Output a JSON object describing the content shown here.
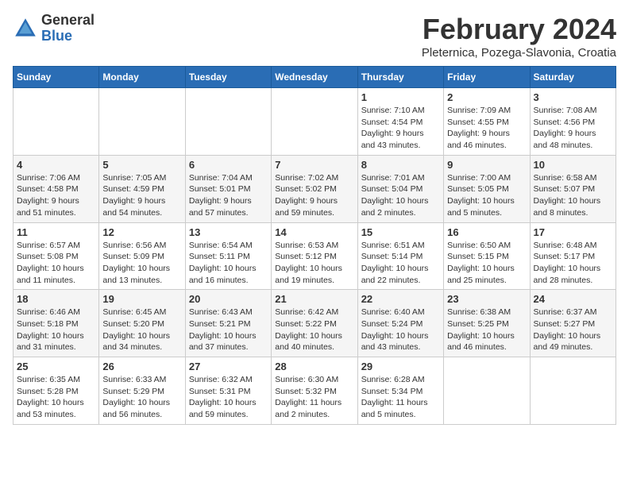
{
  "logo": {
    "general": "General",
    "blue": "Blue"
  },
  "header": {
    "month": "February 2024",
    "location": "Pleternica, Pozega-Slavonia, Croatia"
  },
  "weekdays": [
    "Sunday",
    "Monday",
    "Tuesday",
    "Wednesday",
    "Thursday",
    "Friday",
    "Saturday"
  ],
  "weeks": [
    [
      {
        "day": "",
        "detail": ""
      },
      {
        "day": "",
        "detail": ""
      },
      {
        "day": "",
        "detail": ""
      },
      {
        "day": "",
        "detail": ""
      },
      {
        "day": "1",
        "detail": "Sunrise: 7:10 AM\nSunset: 4:54 PM\nDaylight: 9 hours\nand 43 minutes."
      },
      {
        "day": "2",
        "detail": "Sunrise: 7:09 AM\nSunset: 4:55 PM\nDaylight: 9 hours\nand 46 minutes."
      },
      {
        "day": "3",
        "detail": "Sunrise: 7:08 AM\nSunset: 4:56 PM\nDaylight: 9 hours\nand 48 minutes."
      }
    ],
    [
      {
        "day": "4",
        "detail": "Sunrise: 7:06 AM\nSunset: 4:58 PM\nDaylight: 9 hours\nand 51 minutes."
      },
      {
        "day": "5",
        "detail": "Sunrise: 7:05 AM\nSunset: 4:59 PM\nDaylight: 9 hours\nand 54 minutes."
      },
      {
        "day": "6",
        "detail": "Sunrise: 7:04 AM\nSunset: 5:01 PM\nDaylight: 9 hours\nand 57 minutes."
      },
      {
        "day": "7",
        "detail": "Sunrise: 7:02 AM\nSunset: 5:02 PM\nDaylight: 9 hours\nand 59 minutes."
      },
      {
        "day": "8",
        "detail": "Sunrise: 7:01 AM\nSunset: 5:04 PM\nDaylight: 10 hours\nand 2 minutes."
      },
      {
        "day": "9",
        "detail": "Sunrise: 7:00 AM\nSunset: 5:05 PM\nDaylight: 10 hours\nand 5 minutes."
      },
      {
        "day": "10",
        "detail": "Sunrise: 6:58 AM\nSunset: 5:07 PM\nDaylight: 10 hours\nand 8 minutes."
      }
    ],
    [
      {
        "day": "11",
        "detail": "Sunrise: 6:57 AM\nSunset: 5:08 PM\nDaylight: 10 hours\nand 11 minutes."
      },
      {
        "day": "12",
        "detail": "Sunrise: 6:56 AM\nSunset: 5:09 PM\nDaylight: 10 hours\nand 13 minutes."
      },
      {
        "day": "13",
        "detail": "Sunrise: 6:54 AM\nSunset: 5:11 PM\nDaylight: 10 hours\nand 16 minutes."
      },
      {
        "day": "14",
        "detail": "Sunrise: 6:53 AM\nSunset: 5:12 PM\nDaylight: 10 hours\nand 19 minutes."
      },
      {
        "day": "15",
        "detail": "Sunrise: 6:51 AM\nSunset: 5:14 PM\nDaylight: 10 hours\nand 22 minutes."
      },
      {
        "day": "16",
        "detail": "Sunrise: 6:50 AM\nSunset: 5:15 PM\nDaylight: 10 hours\nand 25 minutes."
      },
      {
        "day": "17",
        "detail": "Sunrise: 6:48 AM\nSunset: 5:17 PM\nDaylight: 10 hours\nand 28 minutes."
      }
    ],
    [
      {
        "day": "18",
        "detail": "Sunrise: 6:46 AM\nSunset: 5:18 PM\nDaylight: 10 hours\nand 31 minutes."
      },
      {
        "day": "19",
        "detail": "Sunrise: 6:45 AM\nSunset: 5:20 PM\nDaylight: 10 hours\nand 34 minutes."
      },
      {
        "day": "20",
        "detail": "Sunrise: 6:43 AM\nSunset: 5:21 PM\nDaylight: 10 hours\nand 37 minutes."
      },
      {
        "day": "21",
        "detail": "Sunrise: 6:42 AM\nSunset: 5:22 PM\nDaylight: 10 hours\nand 40 minutes."
      },
      {
        "day": "22",
        "detail": "Sunrise: 6:40 AM\nSunset: 5:24 PM\nDaylight: 10 hours\nand 43 minutes."
      },
      {
        "day": "23",
        "detail": "Sunrise: 6:38 AM\nSunset: 5:25 PM\nDaylight: 10 hours\nand 46 minutes."
      },
      {
        "day": "24",
        "detail": "Sunrise: 6:37 AM\nSunset: 5:27 PM\nDaylight: 10 hours\nand 49 minutes."
      }
    ],
    [
      {
        "day": "25",
        "detail": "Sunrise: 6:35 AM\nSunset: 5:28 PM\nDaylight: 10 hours\nand 53 minutes."
      },
      {
        "day": "26",
        "detail": "Sunrise: 6:33 AM\nSunset: 5:29 PM\nDaylight: 10 hours\nand 56 minutes."
      },
      {
        "day": "27",
        "detail": "Sunrise: 6:32 AM\nSunset: 5:31 PM\nDaylight: 10 hours\nand 59 minutes."
      },
      {
        "day": "28",
        "detail": "Sunrise: 6:30 AM\nSunset: 5:32 PM\nDaylight: 11 hours\nand 2 minutes."
      },
      {
        "day": "29",
        "detail": "Sunrise: 6:28 AM\nSunset: 5:34 PM\nDaylight: 11 hours\nand 5 minutes."
      },
      {
        "day": "",
        "detail": ""
      },
      {
        "day": "",
        "detail": ""
      }
    ]
  ]
}
